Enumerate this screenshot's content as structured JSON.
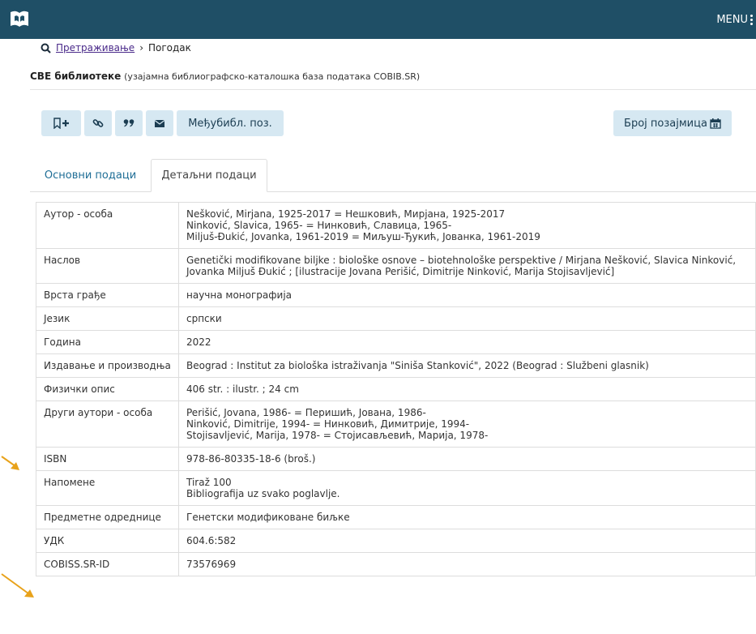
{
  "header": {
    "menu_label": "MENU",
    "logo_icon": "library-logo-icon",
    "bar_color": "#1f4f66"
  },
  "breadcrumb": {
    "search_link": "Претраживање",
    "current": "Погодак"
  },
  "database": {
    "name": "СВЕ библиотеке",
    "description": "(узајамна библиографско-каталошка база података COBIB.SR)"
  },
  "toolbar": {
    "bookmark_add_icon": "bookmark-plus-icon",
    "link_icon": "link-icon",
    "cite_icon": "quote-icon",
    "email_icon": "envelope-icon",
    "interlibrary_label": "Међубибл. поз.",
    "loans_label": "Број позајмица",
    "loans_icon": "calendar-icon"
  },
  "tabs": [
    {
      "label": "Основни подаци"
    },
    {
      "label": "Детаљни подаци"
    }
  ],
  "details": [
    {
      "key": "Аутор - особа",
      "lines": [
        "Nešković, Mirjana, 1925-2017 = Нешковић, Мирјана, 1925-2017",
        "Ninković, Slavica, 1965- = Нинковић, Славица, 1965-",
        "Milјuš-Đukić, Jovanka, 1961-2019 = Миљуш-Ђукић, Јованка, 1961-2019"
      ]
    },
    {
      "key": "Наслов",
      "lines": [
        "Genetički modifikovane biljke : biološke osnove – biotehnološke perspektive / Mirjana Nešković, Slavica Ninković,",
        "Jovanka Miljuš Đukić ; [ilustracije Jovana Perišić, Dimitrije Ninković, Marija Stojisavljević]"
      ]
    },
    {
      "key": "Врста грађе",
      "lines": [
        "научна монографија"
      ]
    },
    {
      "key": "Језик",
      "lines": [
        "српски"
      ]
    },
    {
      "key": "Година",
      "lines": [
        "2022"
      ]
    },
    {
      "key": "Издавање и производња",
      "lines": [
        "Beograd : Institut za biološka istraživanja \"Siniša Stanković\", 2022 (Beograd : Službeni glasnik)"
      ]
    },
    {
      "key": "Физички опис",
      "lines": [
        "406 str. : ilustr. ; 24 cm"
      ]
    },
    {
      "key": "Други аутори - особа",
      "lines": [
        "Perišić, Jovana, 1986- = Перишић, Јована, 1986-",
        "Ninković, Dimitrije, 1994- = Нинковић, Димитрије, 1994-",
        "Stojisavljević, Marija, 1978- = Стојисављевић, Марија, 1978-"
      ]
    },
    {
      "key": "ISBN",
      "lines": [
        "978-86-80335-18-6 (broš.)"
      ]
    },
    {
      "key": "Напомене",
      "lines": [
        "Tiraž 100",
        "Bibliografija uz svako poglavlje."
      ]
    },
    {
      "key": "Предметне одреднице",
      "lines": [
        "Генетски модификоване биљке"
      ]
    },
    {
      "key": "УДК",
      "lines": [
        "604.6:582"
      ]
    },
    {
      "key": "COBISS.SR-ID",
      "lines": [
        "73576969"
      ]
    }
  ],
  "annotation_color": "#e8a21a"
}
